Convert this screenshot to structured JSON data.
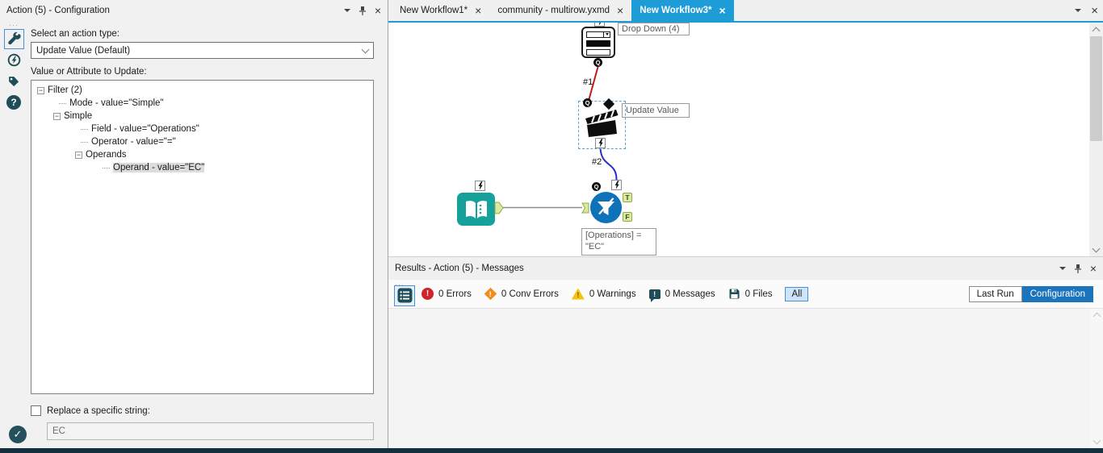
{
  "glyphs": {
    "close": "×",
    "minus": "−",
    "check": "✓",
    "question": "?",
    "exclaim": "!",
    "ellipsis": "···"
  },
  "config_panel": {
    "title": "Action (5) - Configuration",
    "action_type_label": "Select an action type:",
    "action_type_value": "Update Value (Default)",
    "tree_label": "Value or Attribute to Update:",
    "tree_items": [
      {
        "label": "Filter (2)",
        "level": 0,
        "expander": true,
        "selected": false
      },
      {
        "label": "Mode - value=\"Simple\"",
        "level": 1,
        "expander": false,
        "selected": false
      },
      {
        "label": "Simple",
        "level": 1,
        "expander": true,
        "selected": false
      },
      {
        "label": "Field - value=\"Operations\"",
        "level": 2,
        "expander": false,
        "selected": false
      },
      {
        "label": "Operator - value=\"=\"",
        "level": 2,
        "expander": false,
        "selected": false
      },
      {
        "label": "Operands",
        "level": 2,
        "expander": true,
        "selected": false
      },
      {
        "label": "Operand - value=\"EC\"",
        "level": 3,
        "expander": false,
        "selected": true
      }
    ],
    "replace_label": "Replace a specific string:",
    "replace_value": "EC"
  },
  "tab_bar": {
    "tabs": [
      {
        "label": "New Workflow1*",
        "active": false
      },
      {
        "label": "community - multirow.yxmd",
        "active": false
      },
      {
        "label": "New Workflow3*",
        "active": true
      }
    ]
  },
  "canvas": {
    "annotations": {
      "drop_down": "Drop Down (4)",
      "update_value": "Update Value",
      "filter_line1": "[Operations] =",
      "filter_line2": "\"EC\""
    },
    "connection_labels": {
      "first": "#1",
      "second": "#2"
    },
    "anchors": {
      "q": "Q",
      "true": "T",
      "false": "F"
    }
  },
  "results_panel": {
    "title": "Results - Action (5) - Messages",
    "counters": [
      {
        "label": "0 Errors"
      },
      {
        "label": "0 Conv Errors"
      },
      {
        "label": "0 Warnings"
      },
      {
        "label": "0 Messages"
      },
      {
        "label": "0 Files"
      }
    ],
    "filter_all": "All",
    "view_buttons": [
      {
        "label": "Last Run",
        "active": false
      },
      {
        "label": "Configuration",
        "active": true
      }
    ]
  },
  "colors": {
    "active_tab": "#1e9cd7",
    "configuration_button": "#1c75bc",
    "tool_text_input": "#16a29b",
    "tool_filter": "#0d72b7",
    "icon_slate": "#1e4d57",
    "connection_red": "#c11b17",
    "connection_blue": "#2b2bd5",
    "anchor_green": "#dbe7a6"
  }
}
